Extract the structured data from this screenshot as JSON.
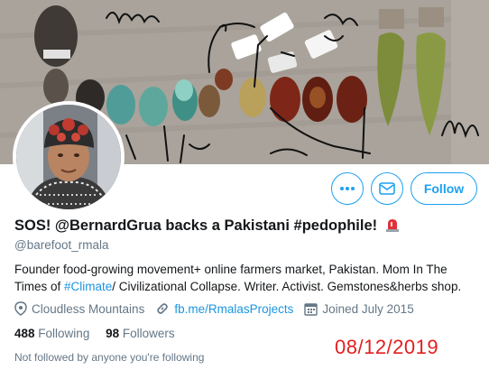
{
  "profile": {
    "display_name": "SOS! @BernardGrua backs a Pakistani #pedophile!",
    "handle": "@barefoot_rmala",
    "bio_line1": "Founder food-growing movement+ online farmers market, Pakistan. Mom In The",
    "bio_line2_pre": "Times of ",
    "bio_hashtag": "#Climate",
    "bio_line2_post": "/ Civilizational Collapse. Writer. Activist. Gemstones&herbs shop.",
    "location": "Cloudless Mountains",
    "website": "fb.me/RmalasProjects",
    "joined": "Joined July 2015"
  },
  "stats": {
    "following_count": "488",
    "following_label": "Following",
    "followers_count": "98",
    "followers_label": "Followers"
  },
  "social_context": "Not followed by anyone you're following",
  "actions": {
    "follow_label": "Follow",
    "more_icon": "more-dots-icon",
    "message_icon": "envelope-icon"
  },
  "overlay": {
    "date_stamp": "08/12/2019"
  },
  "colors": {
    "accent": "#1da1f2",
    "link": "#1b95e0",
    "secondary_text": "#657786",
    "date_red": "#e21e1e"
  }
}
